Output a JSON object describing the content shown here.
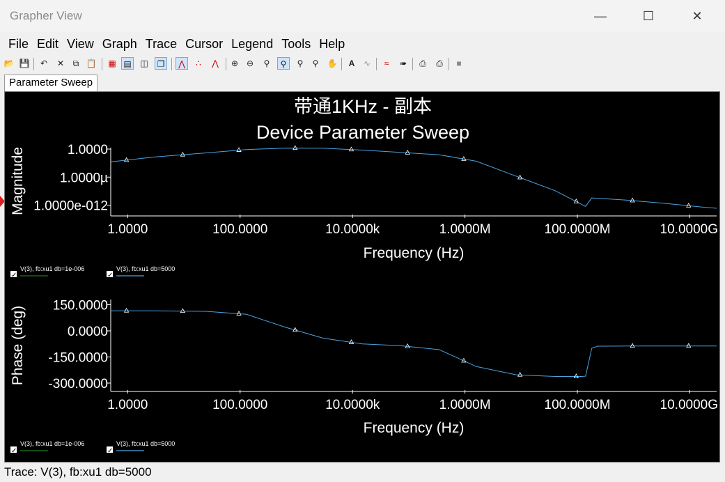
{
  "window": {
    "title": "Grapher View"
  },
  "menu": [
    "File",
    "Edit",
    "View",
    "Graph",
    "Trace",
    "Cursor",
    "Legend",
    "Tools",
    "Help"
  ],
  "tabs": [
    "Parameter Sweep"
  ],
  "status": "Trace: V(3), fb:xu1 db=5000",
  "toolbar_icons": [
    "open-icon",
    "save-icon",
    "undo-icon",
    "cut-icon",
    "copy-icon",
    "paste-icon",
    "grid-icon",
    "legend-icon",
    "cursors-icon",
    "overlay-icon",
    "line-icon",
    "dots-icon",
    "line-dots-icon",
    "zoom-in-icon",
    "zoom-out-icon",
    "zoom-fit-icon",
    "zoom-area-icon",
    "zoom-x-icon",
    "zoom-y-icon",
    "pan-icon",
    "text-icon",
    "annotate-icon",
    "trace-icon",
    "export-icon",
    "print-icon",
    "print-preview-icon",
    "stop-icon"
  ],
  "colors": {
    "trace1": "#1a7a1a",
    "trace2": "#4aa3e0",
    "plot_bg": "#000000",
    "text": "#ffffff",
    "marker": "#e02020"
  },
  "chart_data": [
    {
      "type": "line",
      "title": "带通1KHz - 副本",
      "subtitle": "Device Parameter Sweep",
      "xlabel": "Frequency (Hz)",
      "ylabel": "Magnitude",
      "xscale": "log",
      "yscale": "log",
      "xlim": [
        0.5,
        30000000000
      ],
      "ylim": [
        1e-14,
        1
      ],
      "xticks": [
        1,
        100,
        10000,
        1000000,
        100000000,
        10000000000
      ],
      "xtick_labels": [
        "1.0000",
        "100.0000",
        "10.0000k",
        "1.0000M",
        "100.0000M",
        "10.0000G"
      ],
      "yticks": [
        1e-12,
        1e-06,
        1
      ],
      "ytick_labels": [
        "1.0000e-012",
        "1.0000µ",
        "1.0000"
      ],
      "legend": [
        "V(3), fb:xu1 db=1e-006",
        "V(3), fb:xu1 db=5000"
      ],
      "series": [
        {
          "name": "V(3), fb:xu1 db=5000",
          "x": [
            0.5,
            3,
            25,
            130,
            650,
            3000,
            15000,
            70000,
            350000,
            1600000,
            8000000,
            40000000,
            140000000,
            180000000,
            230000000,
            700000000,
            3500000000,
            17000000000,
            30000000000
          ],
          "y": [
            0.0018,
            0.02,
            0.15,
            0.8,
            1.6,
            1.5,
            0.6,
            0.2,
            0.06,
            0.0025,
            1.7e-06,
            1.3e-09,
            5.5e-13,
            3.5e-11,
            3e-11,
            1.3e-11,
            2.5e-12,
            3.8e-13,
            2.2e-13
          ]
        }
      ]
    },
    {
      "type": "line",
      "xlabel": "Frequency (Hz)",
      "ylabel": "Phase (deg)",
      "xscale": "log",
      "xlim": [
        0.5,
        30000000000
      ],
      "ylim": [
        -340,
        180
      ],
      "xticks": [
        1,
        100,
        10000,
        1000000,
        100000000,
        10000000000
      ],
      "xtick_labels": [
        "1.0000",
        "100.0000",
        "10.0000k",
        "1.0000M",
        "100.0000M",
        "10.0000G"
      ],
      "yticks": [
        150,
        0,
        -150,
        -300
      ],
      "ytick_labels": [
        "150.0000",
        "0.0000",
        "-150.0000",
        "-300.0000"
      ],
      "legend": [
        "V(3), fb:xu1 db=1e-006",
        "V(3), fb:xu1 db=5000"
      ],
      "series": [
        {
          "name": "V(3), fb:xu1 db=5000",
          "x": [
            0.5,
            3,
            25,
            130,
            650,
            3000,
            15000,
            70000,
            350000,
            1600000,
            8000000,
            40000000,
            120000000,
            140000000,
            180000000,
            230000000,
            700000000,
            3500000000,
            17000000000,
            30000000000
          ],
          "y": [
            115,
            115,
            112,
            95,
            20,
            -42,
            -75,
            -85,
            -108,
            -205,
            -252,
            -262,
            -262,
            -260,
            -100,
            -88,
            -87,
            -87,
            -87,
            -87
          ]
        }
      ]
    }
  ]
}
